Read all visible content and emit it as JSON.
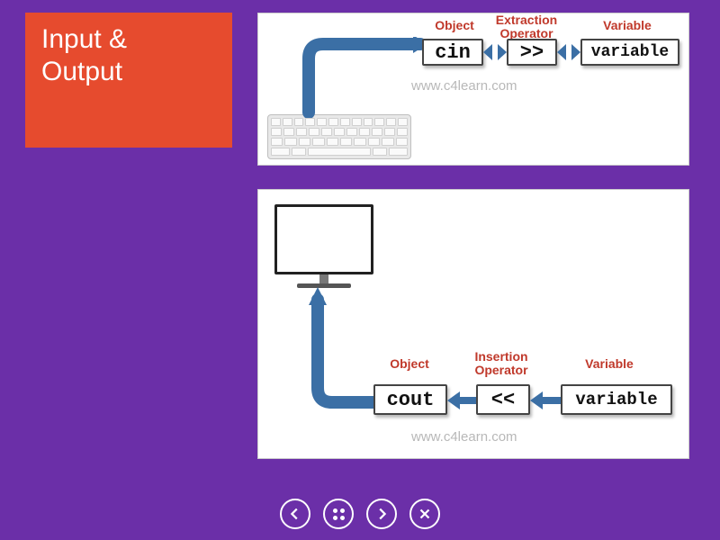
{
  "title": {
    "line1": "Input  &",
    "line2": "Output"
  },
  "top": {
    "labels": {
      "object": "Object",
      "operator": "Extraction\nOperator",
      "variable": "Variable"
    },
    "boxes": {
      "object": "cin",
      "operator": ">>",
      "variable": "variable"
    },
    "watermark": "www.c4learn.com"
  },
  "bottom": {
    "labels": {
      "object": "Object",
      "operator": "Insertion\nOperator",
      "variable": "Variable"
    },
    "boxes": {
      "object": "cout",
      "operator": "<<",
      "variable": "variable"
    },
    "watermark": "www.c4learn.com"
  },
  "nav": {
    "prev": "prev",
    "grid": "grid",
    "next": "next",
    "close": "close"
  }
}
